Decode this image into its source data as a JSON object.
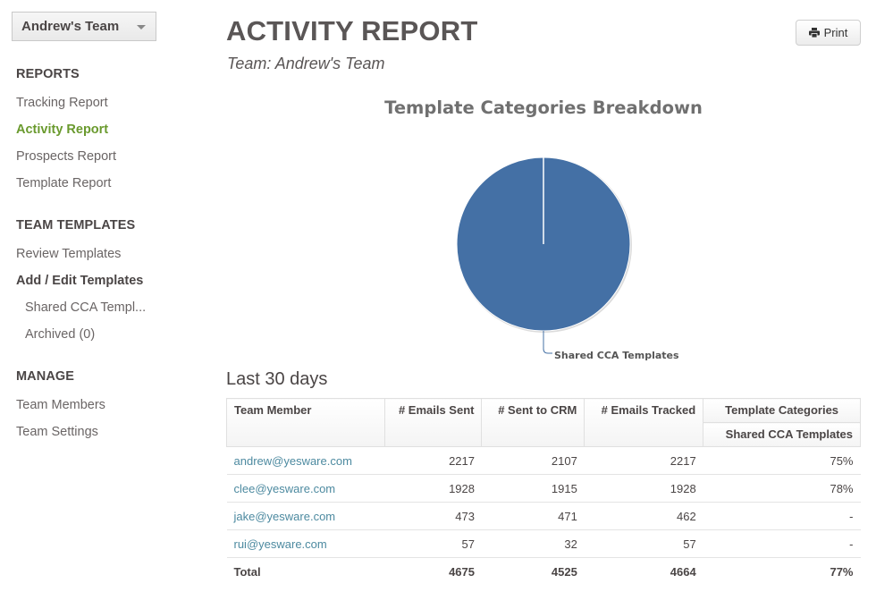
{
  "sidebar": {
    "team_selector": {
      "value": "Andrew's Team",
      "icon": "caret-down-icon"
    },
    "sections": [
      {
        "title": "REPORTS",
        "items": [
          {
            "label": "Tracking Report",
            "active": false
          },
          {
            "label": "Activity Report",
            "active": true
          },
          {
            "label": "Prospects Report",
            "active": false
          },
          {
            "label": "Template Report",
            "active": false
          }
        ]
      },
      {
        "title": "TEAM TEMPLATES",
        "items": [
          {
            "label": "Review Templates"
          },
          {
            "label": "Add / Edit Templates",
            "bold": true
          },
          {
            "label": "Shared CCA Templ...",
            "sub": true
          },
          {
            "label": "Archived (0)",
            "sub": true
          }
        ]
      },
      {
        "title": "MANAGE",
        "items": [
          {
            "label": "Team Members"
          },
          {
            "label": "Team Settings"
          }
        ]
      }
    ]
  },
  "header": {
    "title": "ACTIVITY REPORT",
    "subtitle": "Team: Andrew's Team",
    "print_label": "Print",
    "print_icon": "printer-icon"
  },
  "chart_data": {
    "type": "pie",
    "title": "Template Categories Breakdown",
    "categories": [
      "Shared CCA Templates"
    ],
    "values": [
      100
    ],
    "colors": [
      "#4470a5"
    ],
    "labels": [
      "Shared CCA Templates"
    ],
    "legend": "none"
  },
  "report": {
    "period": "Last 30 days",
    "columns": {
      "member": "Team Member",
      "emails_sent": "# Emails Sent",
      "sent_to_crm": "# Sent to CRM",
      "emails_tracked": "# Emails Tracked",
      "group": "Template Categories",
      "category": "Shared CCA Templates"
    },
    "rows": [
      {
        "member": "andrew@yesware.com",
        "emails_sent": "2217",
        "sent_to_crm": "2107",
        "emails_tracked": "2217",
        "category": "75%"
      },
      {
        "member": "clee@yesware.com",
        "emails_sent": "1928",
        "sent_to_crm": "1915",
        "emails_tracked": "1928",
        "category": "78%"
      },
      {
        "member": "jake@yesware.com",
        "emails_sent": "473",
        "sent_to_crm": "471",
        "emails_tracked": "462",
        "category": "-"
      },
      {
        "member": "rui@yesware.com",
        "emails_sent": "57",
        "sent_to_crm": "32",
        "emails_tracked": "57",
        "category": "-"
      }
    ],
    "total": {
      "label": "Total",
      "emails_sent": "4675",
      "sent_to_crm": "4525",
      "emails_tracked": "4664",
      "category": "77%"
    }
  }
}
